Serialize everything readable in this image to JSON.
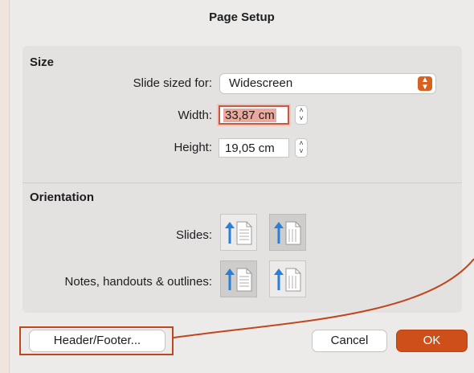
{
  "dialog": {
    "title": "Page Setup",
    "size_section": {
      "title": "Size",
      "slide_sized_for_label": "Slide sized for:",
      "slide_sized_for_value": "Widescreen",
      "width_label": "Width:",
      "width_value": "33,87 cm",
      "height_label": "Height:",
      "height_value": "19,05 cm"
    },
    "orientation_section": {
      "title": "Orientation",
      "slides_label": "Slides:",
      "notes_label": "Notes, handouts & outlines:",
      "slides_selected": "portrait",
      "notes_selected": "portrait"
    },
    "buttons": {
      "header_footer": "Header/Footer...",
      "cancel": "Cancel",
      "ok": "OK"
    }
  },
  "colors": {
    "accent": "#cf4f1a",
    "annotation": "#c0461f",
    "focus_highlight": "#eba99d"
  }
}
